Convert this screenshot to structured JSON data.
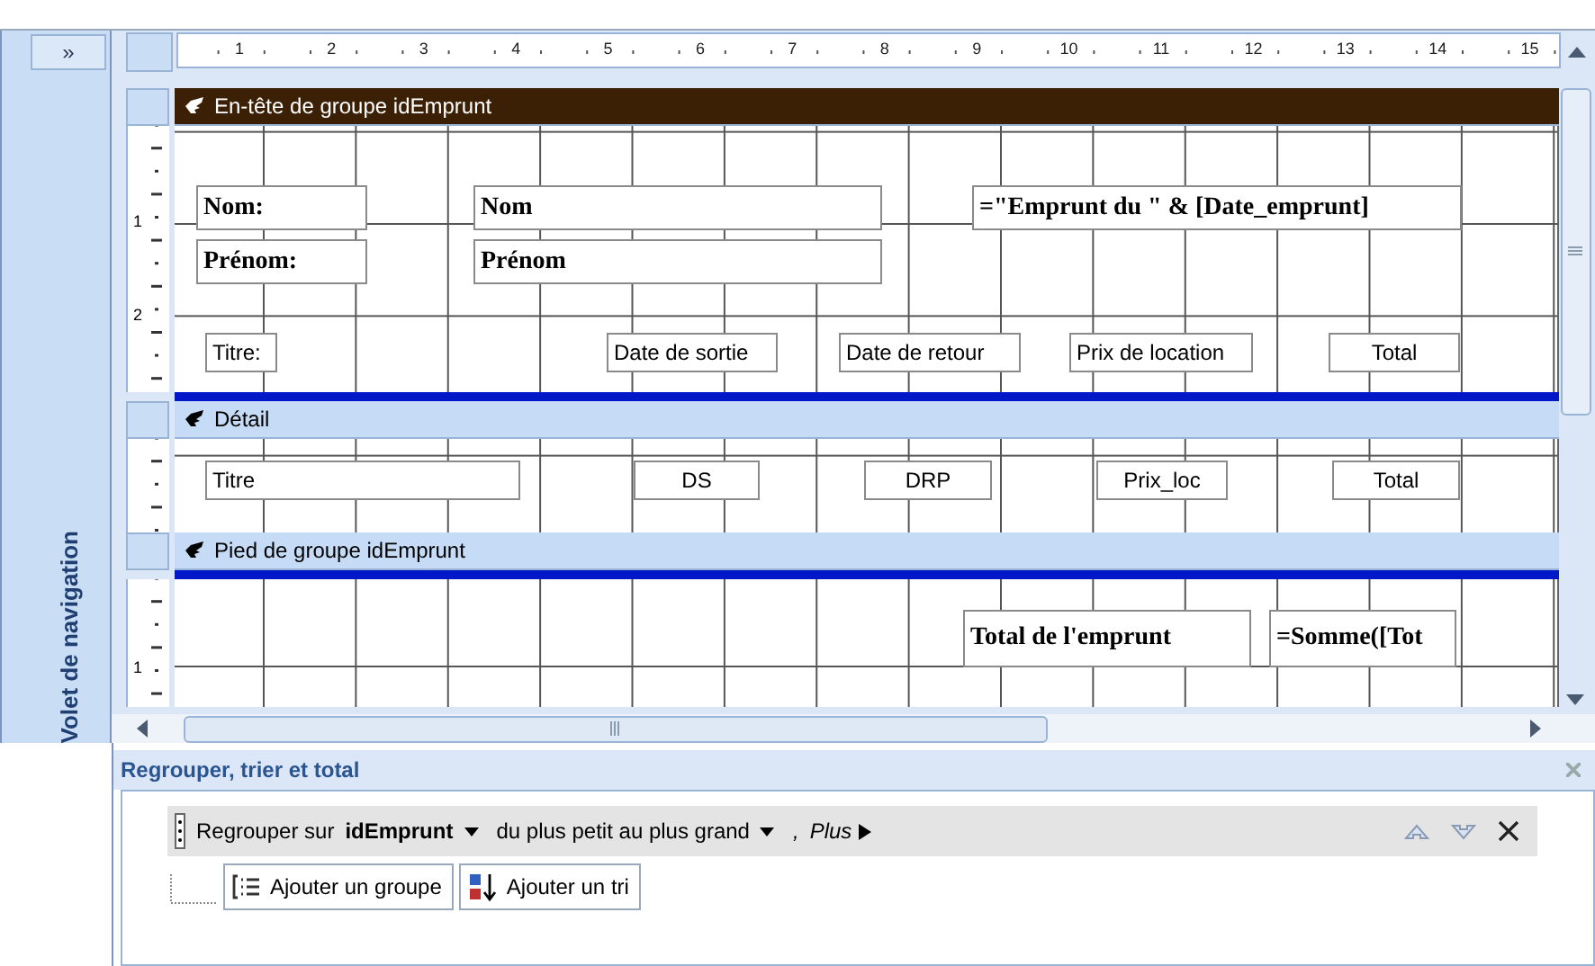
{
  "navigation_pane": {
    "expand_button": "»",
    "title": "Volet de navigation"
  },
  "ruler": {
    "labels": [
      "1",
      "2",
      "3",
      "4",
      "5",
      "6",
      "7",
      "8",
      "9",
      "10",
      "11",
      "12",
      "13",
      "14",
      "15"
    ]
  },
  "sections": [
    {
      "title": "En-tête de groupe idEmprunt",
      "selected": true,
      "ruler_labels": [
        "1",
        "2"
      ],
      "controls": [
        {
          "kind": "title",
          "text": "Nom:"
        },
        {
          "kind": "title",
          "text": "Prénom:"
        },
        {
          "kind": "title",
          "text": "Nom"
        },
        {
          "kind": "title",
          "text": "Prénom"
        },
        {
          "kind": "title",
          "text": "=\"Emprunt du \" & [Date_emprunt]"
        },
        {
          "kind": "text",
          "text": "Titre:"
        },
        {
          "kind": "text",
          "text": "Date de sortie"
        },
        {
          "kind": "text",
          "text": "Date de retour"
        },
        {
          "kind": "text",
          "text": "Prix de location"
        },
        {
          "kind": "text",
          "text": "Total"
        }
      ]
    },
    {
      "title": "Détail",
      "selected": false,
      "controls": [
        {
          "kind": "text",
          "text": "Titre"
        },
        {
          "kind": "text",
          "text": "DS"
        },
        {
          "kind": "text",
          "text": "DRP"
        },
        {
          "kind": "text",
          "text": "Prix_loc"
        },
        {
          "kind": "text",
          "text": "Total"
        }
      ]
    },
    {
      "title": "Pied de groupe idEmprunt",
      "selected": false,
      "ruler_labels": [
        "1"
      ],
      "controls": [
        {
          "kind": "title",
          "text": "Total de l'emprunt"
        },
        {
          "kind": "title",
          "text": "=Somme([Tot"
        }
      ]
    }
  ],
  "group_pane": {
    "title": "Regrouper, trier et total",
    "group_row": {
      "prefix": "Regrouper sur",
      "field": "idEmprunt",
      "order": "du plus petit au plus grand",
      "separator": ",",
      "more": "Plus"
    },
    "buttons": [
      {
        "kind": "group",
        "label": "Ajouter un groupe"
      },
      {
        "kind": "sort",
        "label": "Ajouter un tri"
      }
    ]
  }
}
